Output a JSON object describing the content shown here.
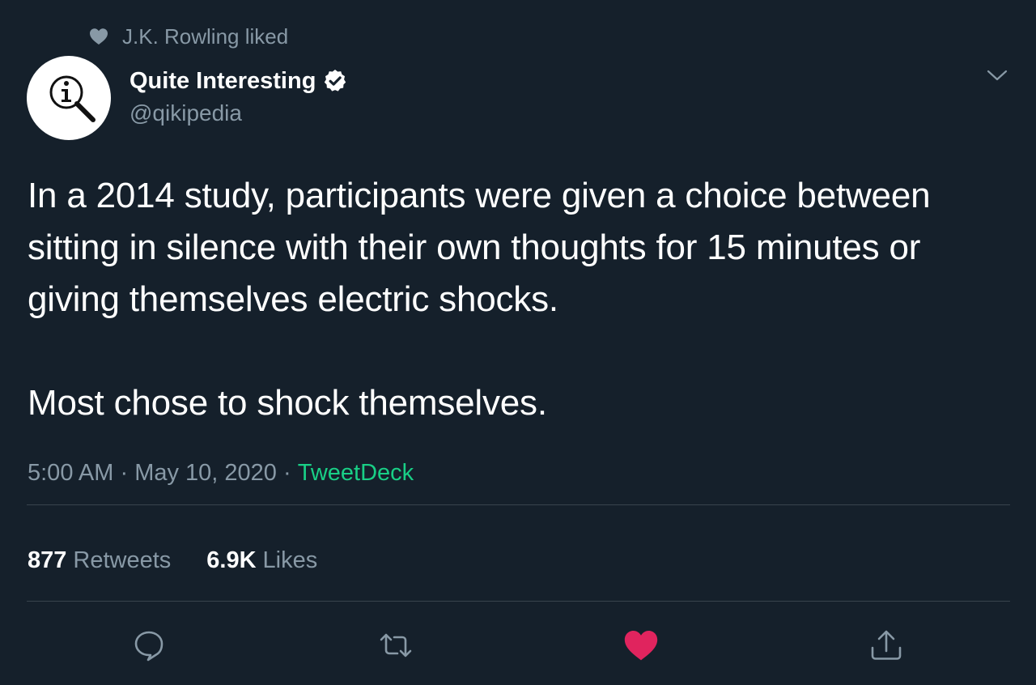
{
  "colors": {
    "background": "#15202b",
    "text_primary": "#ffffff",
    "text_secondary": "#8899a6",
    "source_link": "#19cf86",
    "like_active": "#e0245e",
    "divider": "#38444d"
  },
  "social_context": {
    "icon": "heart-icon",
    "text": "J.K. Rowling liked"
  },
  "author": {
    "avatar_icon": "info-magnifier-icon",
    "name": "Quite Interesting",
    "verified_icon": "verified-badge-icon",
    "handle": "@qikipedia"
  },
  "menu_icon": "chevron-down-icon",
  "tweet": {
    "paragraphs": [
      "In a 2014 study, participants were given a choice between sitting in silence with their own thoughts for 15 minutes or giving themselves electric shocks.",
      "Most chose to shock themselves."
    ]
  },
  "meta": {
    "time": "5:00 AM",
    "separator": " · ",
    "date": "May 10, 2020",
    "source": "TweetDeck"
  },
  "stats": {
    "retweets_count": "877",
    "retweets_label": "Retweets",
    "likes_count": "6.9K",
    "likes_label": "Likes"
  },
  "actions": {
    "reply_icon": "reply-icon",
    "retweet_icon": "retweet-icon",
    "like_icon": "heart-icon",
    "like_state": "liked",
    "share_icon": "share-icon"
  }
}
